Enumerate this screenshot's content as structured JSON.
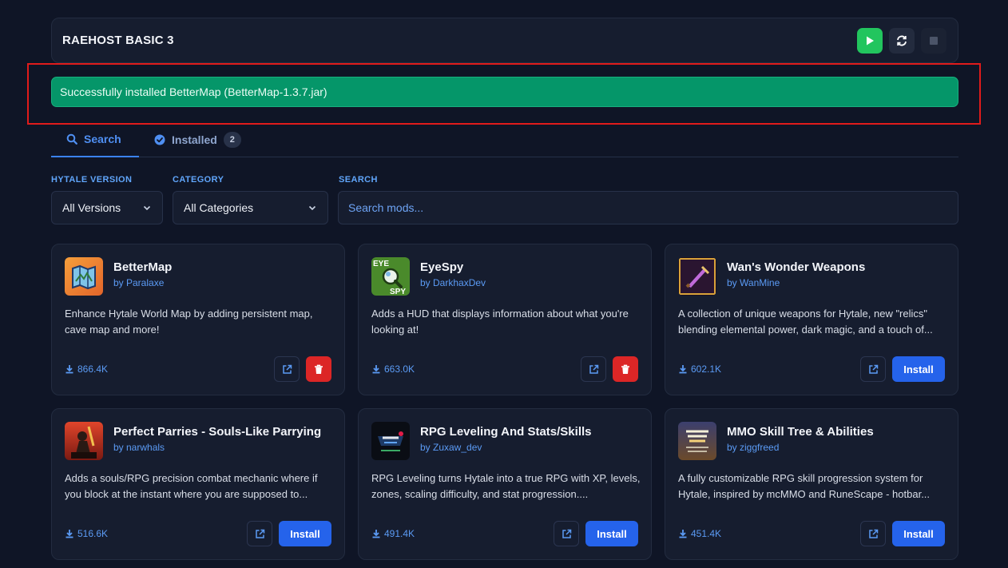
{
  "server": {
    "title": "RAEHOST BASIC 3"
  },
  "alert": {
    "message": "Successfully installed BetterMap (BetterMap-1.3.7.jar)"
  },
  "tabs": [
    {
      "label": "Search",
      "active": true
    },
    {
      "label": "Installed",
      "count": "2"
    }
  ],
  "filters": {
    "version_label": "HYTALE VERSION",
    "version_value": "All Versions",
    "category_label": "CATEGORY",
    "category_value": "All Categories",
    "search_label": "SEARCH",
    "search_placeholder": "Search mods..."
  },
  "mods": [
    {
      "name": "BetterMap",
      "author": "by Paralaxe",
      "description": "Enhance Hytale World Map by adding persistent map, cave map and more!",
      "downloads": "866.4K",
      "installed": true
    },
    {
      "name": "EyeSpy",
      "author": "by DarkhaxDev",
      "description": "Adds a HUD that displays information about what you're looking at!",
      "downloads": "663.0K",
      "installed": true,
      "icon_text_top": "EYE",
      "icon_text_bottom": "SPY"
    },
    {
      "name": "Wan's Wonder Weapons",
      "author": "by WanMine",
      "description": "A collection of unique weapons for Hytale, new \"relics\" blending elemental power, dark magic, and a touch of...",
      "downloads": "602.1K",
      "installed": false,
      "install_label": "Install"
    },
    {
      "name": "Perfect Parries - Souls-Like Parrying",
      "author": "by narwhals",
      "description": "Adds a souls/RPG precision combat mechanic where if you block at the instant where you are supposed to...",
      "downloads": "516.6K",
      "installed": false,
      "install_label": "Install"
    },
    {
      "name": "RPG Leveling And Stats/Skills",
      "author": "by Zuxaw_dev",
      "description": "RPG Leveling turns Hytale into a true RPG with XP, levels, zones, scaling difficulty, and stat progression....",
      "downloads": "491.4K",
      "installed": false,
      "install_label": "Install"
    },
    {
      "name": "MMO Skill Tree & Abilities",
      "author": "by ziggfreed",
      "description": "A fully customizable RPG skill progression system for Hytale, inspired by mcMMO and RuneScape - hotbar...",
      "downloads": "451.4K",
      "installed": false,
      "install_label": "Install"
    }
  ],
  "colors": {
    "background": "#0f1526",
    "panel": "#161d2f",
    "accent": "#3b82f6",
    "success": "#059669",
    "danger": "#dc2626",
    "start": "#22c55e"
  }
}
